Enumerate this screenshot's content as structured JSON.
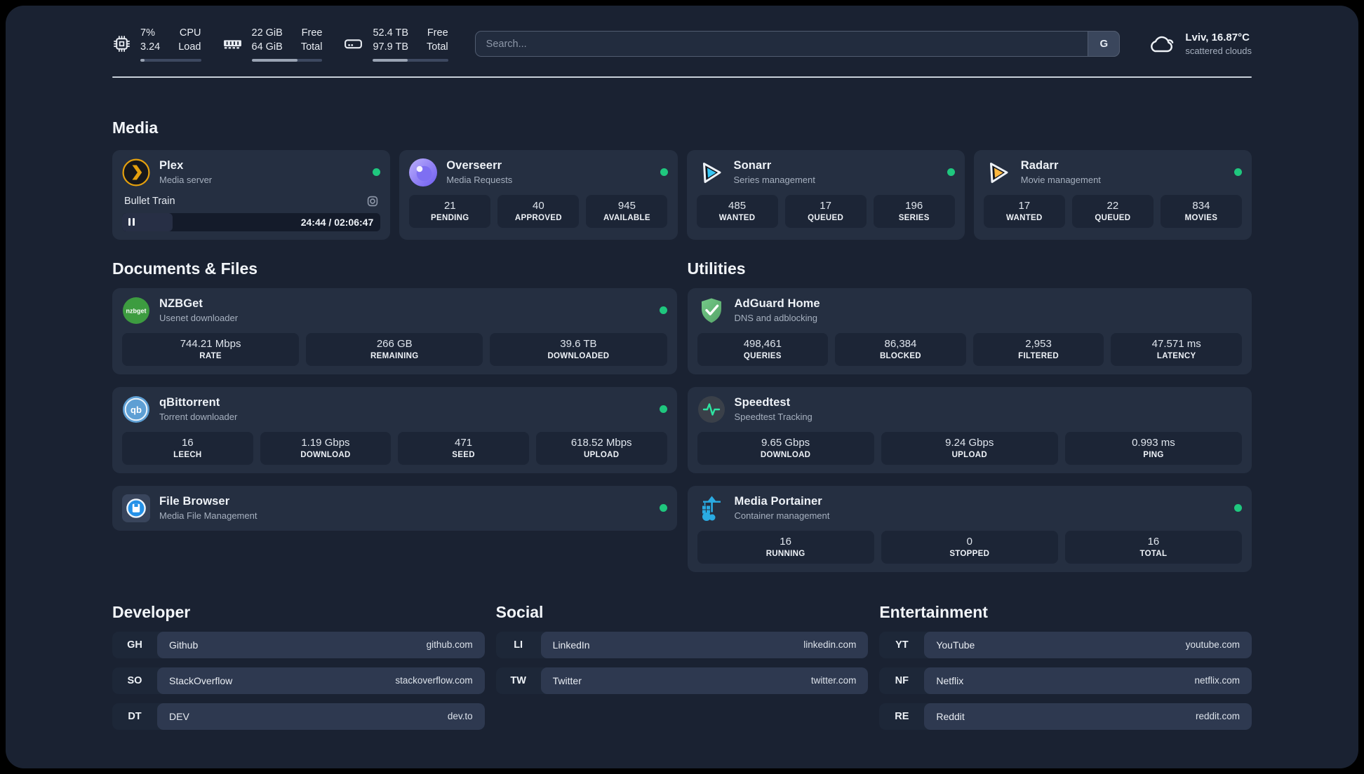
{
  "colors": {
    "background": "#1a2232",
    "card": "#252f41",
    "stat_box": "#1c2536",
    "status_online": "#1fc77e",
    "plex_accent": "#e5a00d",
    "sonarr_accent": "#36c6f4",
    "radarr_accent": "#ffb83d",
    "adguard_accent": "#68c080",
    "portainer_accent": "#2aabe2"
  },
  "monitors": {
    "cpu": {
      "icon": "cpu-icon",
      "top_value": "7%",
      "top_label": "CPU",
      "bottom_value": "3.24",
      "bottom_label": "Load",
      "progress_percent": 7
    },
    "memory": {
      "icon": "memory-icon",
      "top_value": "22 GiB",
      "top_label": "Free",
      "bottom_value": "64 GiB",
      "bottom_label": "Total",
      "progress_percent": 65
    },
    "storage": {
      "icon": "storage-icon",
      "top_value": "52.4 TB",
      "top_label": "Free",
      "bottom_value": "97.9 TB",
      "bottom_label": "Total",
      "progress_percent": 46
    }
  },
  "search": {
    "placeholder": "Search...",
    "provider_button": "G"
  },
  "weather": {
    "icon": "cloud-icon",
    "headline": "Lviv, 16.87°C",
    "condition": "scattered clouds"
  },
  "sections": {
    "media": {
      "title": "Media",
      "apps": [
        {
          "icon": "plex-icon",
          "name": "Plex",
          "description": "Media server",
          "status": "online",
          "now_playing": {
            "title": "Bullet Train",
            "time_display": "24:44 / 02:06:47",
            "progress_percent": 19.5,
            "state": "paused"
          }
        },
        {
          "icon": "overseerr-icon",
          "name": "Overseerr",
          "description": "Media Requests",
          "status": "online",
          "stats": [
            {
              "value": "21",
              "label": "PENDING"
            },
            {
              "value": "40",
              "label": "APPROVED"
            },
            {
              "value": "945",
              "label": "AVAILABLE"
            }
          ]
        },
        {
          "icon": "sonarr-icon",
          "name": "Sonarr",
          "description": "Series management",
          "status": "online",
          "stats": [
            {
              "value": "485",
              "label": "WANTED"
            },
            {
              "value": "17",
              "label": "QUEUED"
            },
            {
              "value": "196",
              "label": "SERIES"
            }
          ]
        },
        {
          "icon": "radarr-icon",
          "name": "Radarr",
          "description": "Movie management",
          "status": "online",
          "stats": [
            {
              "value": "17",
              "label": "WANTED"
            },
            {
              "value": "22",
              "label": "QUEUED"
            },
            {
              "value": "834",
              "label": "MOVIES"
            }
          ]
        }
      ]
    },
    "documents": {
      "title": "Documents & Files",
      "apps": [
        {
          "icon": "nzbget-icon",
          "name": "NZBGet",
          "description": "Usenet downloader",
          "status": "online",
          "stats": [
            {
              "value": "744.21 Mbps",
              "label": "RATE"
            },
            {
              "value": "266 GB",
              "label": "REMAINING"
            },
            {
              "value": "39.6 TB",
              "label": "DOWNLOADED"
            }
          ]
        },
        {
          "icon": "qbittorrent-icon",
          "name": "qBittorrent",
          "description": "Torrent downloader",
          "status": "online",
          "stats": [
            {
              "value": "16",
              "label": "LEECH"
            },
            {
              "value": "1.19 Gbps",
              "label": "DOWNLOAD"
            },
            {
              "value": "471",
              "label": "SEED"
            },
            {
              "value": "618.52 Mbps",
              "label": "UPLOAD"
            }
          ]
        },
        {
          "icon": "filebrowser-icon",
          "name": "File Browser",
          "description": "Media File Management",
          "status": "online"
        }
      ]
    },
    "utilities": {
      "title": "Utilities",
      "apps": [
        {
          "icon": "adguard-icon",
          "name": "AdGuard Home",
          "description": "DNS and adblocking",
          "stats": [
            {
              "value": "498,461",
              "label": "QUERIES"
            },
            {
              "value": "86,384",
              "label": "BLOCKED"
            },
            {
              "value": "2,953",
              "label": "FILTERED"
            },
            {
              "value": "47.571 ms",
              "label": "LATENCY"
            }
          ]
        },
        {
          "icon": "speedtest-icon",
          "name": "Speedtest",
          "description": "Speedtest Tracking",
          "stats": [
            {
              "value": "9.65 Gbps",
              "label": "DOWNLOAD"
            },
            {
              "value": "9.24 Gbps",
              "label": "UPLOAD"
            },
            {
              "value": "0.993 ms",
              "label": "PING"
            }
          ]
        },
        {
          "icon": "portainer-icon",
          "name": "Media Portainer",
          "description": "Container management",
          "status": "online",
          "stats": [
            {
              "value": "16",
              "label": "RUNNING"
            },
            {
              "value": "0",
              "label": "STOPPED"
            },
            {
              "value": "16",
              "label": "TOTAL"
            }
          ]
        }
      ]
    },
    "developer": {
      "title": "Developer",
      "links": [
        {
          "tag": "GH",
          "name": "Github",
          "url": "github.com"
        },
        {
          "tag": "SO",
          "name": "StackOverflow",
          "url": "stackoverflow.com"
        },
        {
          "tag": "DT",
          "name": "DEV",
          "url": "dev.to"
        }
      ]
    },
    "social": {
      "title": "Social",
      "links": [
        {
          "tag": "LI",
          "name": "LinkedIn",
          "url": "linkedin.com"
        },
        {
          "tag": "TW",
          "name": "Twitter",
          "url": "twitter.com"
        }
      ]
    },
    "entertainment": {
      "title": "Entertainment",
      "links": [
        {
          "tag": "YT",
          "name": "YouTube",
          "url": "youtube.com"
        },
        {
          "tag": "NF",
          "name": "Netflix",
          "url": "netflix.com"
        },
        {
          "tag": "RE",
          "name": "Reddit",
          "url": "reddit.com"
        }
      ]
    }
  }
}
